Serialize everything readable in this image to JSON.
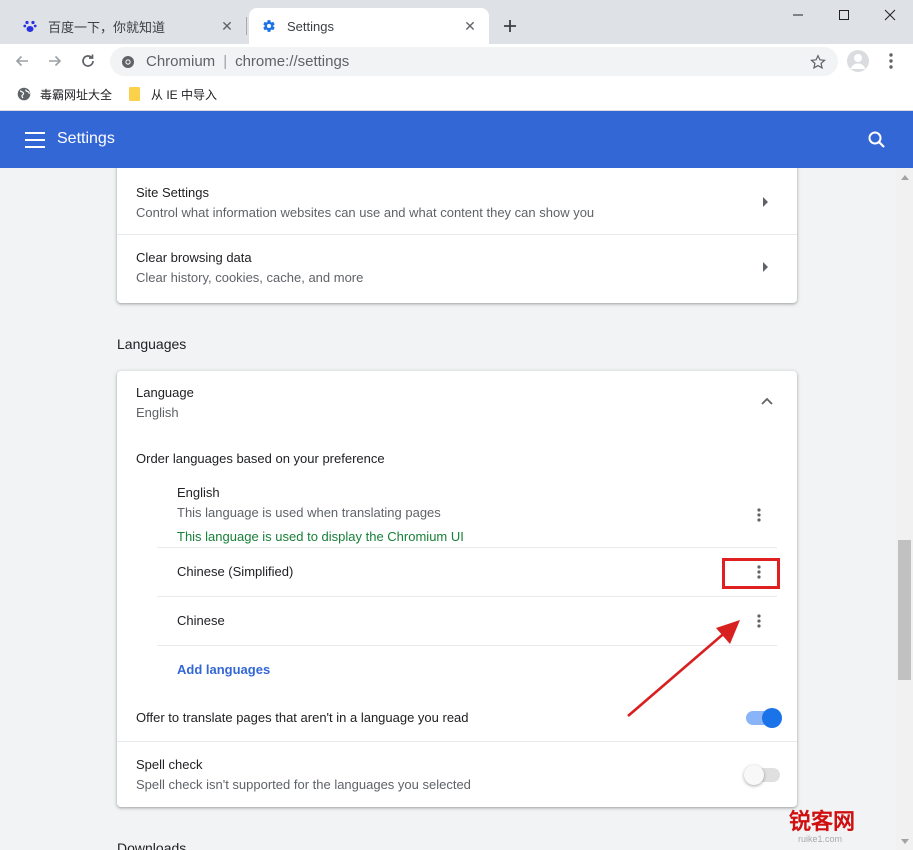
{
  "tabs": [
    {
      "title": "百度一下，你就知道",
      "icon": "baidu-paw-icon"
    },
    {
      "title": "Settings",
      "icon": "gear-icon"
    }
  ],
  "omnibox": {
    "host": "Chromium",
    "url": "chrome://settings"
  },
  "bookmarks": [
    {
      "label": "毒霸网址大全",
      "icon": "globe-icon"
    },
    {
      "label": "从 IE 中导入",
      "icon": "folder-icon"
    }
  ],
  "header": {
    "title": "Settings"
  },
  "privacy": {
    "site_settings": {
      "title": "Site Settings",
      "subtitle": "Control what information websites can use and what content they can show you"
    },
    "clear_data": {
      "title": "Clear browsing data",
      "subtitle": "Clear history, cookies, cache, and more"
    }
  },
  "languages": {
    "section_title": "Languages",
    "language_row": {
      "title": "Language",
      "value": "English"
    },
    "order_label": "Order languages based on your preference",
    "items": [
      {
        "name": "English",
        "note": "This language is used when translating pages",
        "ui_note": "This language is used to display the Chromium UI"
      },
      {
        "name": "Chinese (Simplified)"
      },
      {
        "name": "Chinese"
      }
    ],
    "add_languages": "Add languages",
    "offer_translate": {
      "label": "Offer to translate pages that aren't in a language you read",
      "enabled": true
    },
    "spell_check": {
      "title": "Spell check",
      "subtitle": "Spell check isn't supported for the languages you selected",
      "enabled": false
    }
  },
  "downloads_title": "Downloads",
  "watermark": {
    "text": "锐客网",
    "sub": "ruike1.com"
  },
  "colors": {
    "accent": "#3367d6",
    "highlight": "#e02020",
    "green_note": "#188038",
    "toggle_on": "#1a73e8"
  }
}
